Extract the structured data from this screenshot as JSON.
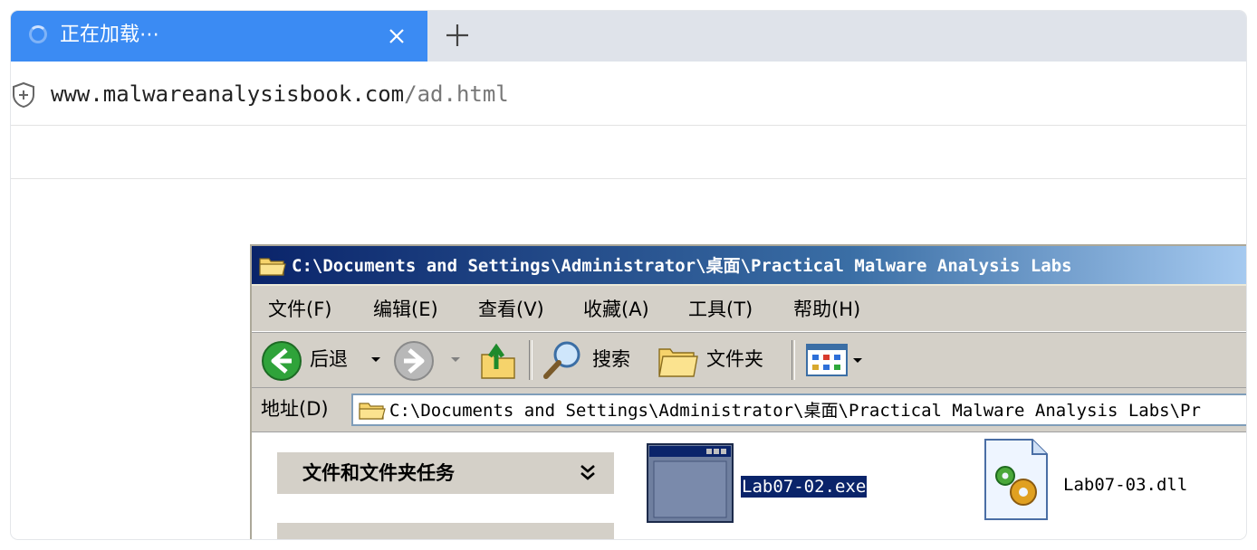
{
  "browser": {
    "tab_title": "正在加载⋯",
    "url_domain": "www.malwareanalysisbook.com",
    "url_path": "/ad.html",
    "accent": "#3b8bf3"
  },
  "explorer": {
    "title": "C:\\Documents and Settings\\Administrator\\桌面\\Practical Malware Analysis Labs",
    "menu": [
      "文件(F)",
      "编辑(E)",
      "查看(V)",
      "收藏(A)",
      "工具(T)",
      "帮助(H)"
    ],
    "toolbar": {
      "back": "后退",
      "search": "搜索",
      "folders": "文件夹"
    },
    "address_label": "地址(D)",
    "address_value": "C:\\Documents and Settings\\Administrator\\桌面\\Practical Malware Analysis Labs\\Pr",
    "task_panel_title": "文件和文件夹任务",
    "files": [
      "Lab07-02.exe",
      "Lab07-03.dll"
    ]
  }
}
